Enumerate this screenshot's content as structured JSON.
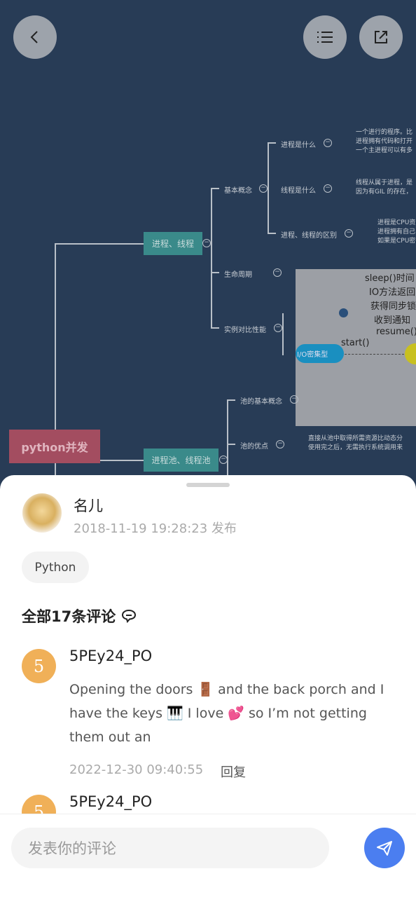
{
  "mindmap": {
    "root": "python并发",
    "nodes": {
      "n1": "进程、线程",
      "n2": "进程池、线程池",
      "basic": "基本概念",
      "what_process": "进程是什么",
      "what_thread": "线程是什么",
      "diff": "进程、线程的区别",
      "lifecycle": "生命周期",
      "compare": "实例对比性能",
      "io": "I/O密集型",
      "pool_basic": "池的基本概念",
      "pool_adv": "池的优点"
    },
    "descriptions": {
      "process": [
        "一个进行的程序。比",
        "进程拥有代码和打开",
        "一个主进程可以有多"
      ],
      "thread": [
        "线程从属于进程，是",
        "因为有GIL 的存在，"
      ],
      "diff": [
        "进程是CPU资",
        "进程拥有自己",
        "如果是CPU密"
      ],
      "pool": [
        "直接从池中取得所需资源比动态分",
        "使用完之后，无需执行系统调用来"
      ]
    },
    "lifecycle_image": [
      "sleep()时间",
      "IO方法返回",
      "获得同步锁",
      "收到通知",
      "resume()",
      "start()"
    ]
  },
  "topbar": {
    "back": "back",
    "toc": "list",
    "share": "share"
  },
  "post": {
    "author": "名儿",
    "time": "2018-11-19 19:28:23 发布",
    "tag": "Python"
  },
  "comments": {
    "title": "全部17条评论",
    "items": [
      {
        "avatar": "5",
        "name": "5PEy24_PO",
        "text": "Opening the doors 🚪 and the back porch and I have the keys 🎹 I love 💕 so I’m not getting them out an",
        "date": "2022-12-30 09:40:55",
        "reply": "回复"
      },
      {
        "avatar": "5",
        "name": "5PEy24_PO"
      }
    ]
  },
  "composer": {
    "placeholder": "发表你的评论"
  },
  "colors": {
    "accent": "#4b7ef0",
    "avatar": "#f0b058",
    "map_bg": "#283c56"
  }
}
